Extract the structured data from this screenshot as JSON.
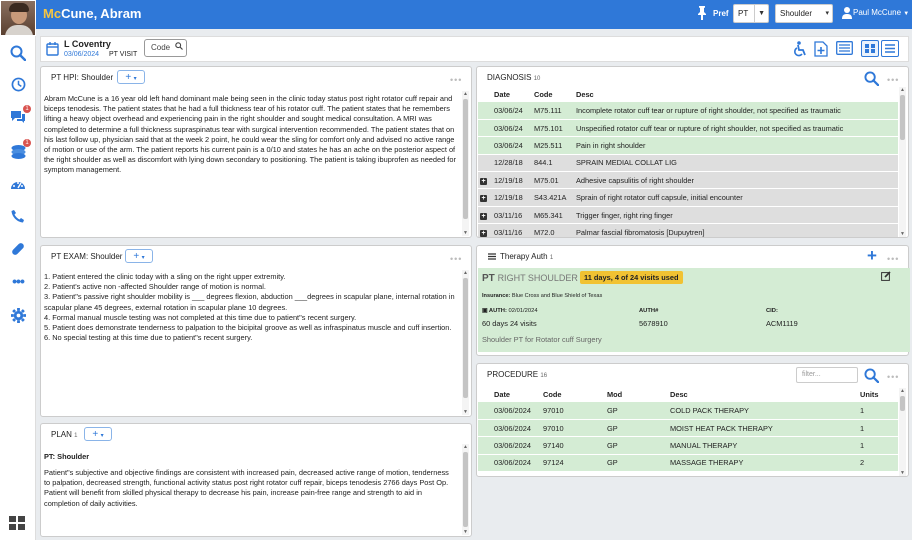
{
  "patient": {
    "initials_styled": "Mc",
    "name_rest": "Cune, Abram"
  },
  "topbar": {
    "pref_label": "Pref",
    "discipline_select": "PT",
    "body_part_select": "Shoulder",
    "user_name": "Paul McCune"
  },
  "sidebar": {
    "icons": [
      "search-icon",
      "clock-icon",
      "messages-icon",
      "tasks-icon",
      "dashboard-icon",
      "phone-icon",
      "pill-icon",
      "more-icon",
      "gear-icon"
    ],
    "badges": {
      "messages": "1",
      "tasks": "1"
    }
  },
  "header": {
    "provider": "L Coventry",
    "visit_date": "03/06/2024",
    "visit_type": "PT VISIT",
    "code_button": "Code"
  },
  "hpi": {
    "title": "PT HPI: Shoulder",
    "text": "Abram McCune is a 16 year old  left hand dominant male being seen in the clinic today status post right rotator cuff repair and biceps tenodesis. The patient states that he had a full thickness tear of his rotator cuff. The patient states that he remembers lifting a heavy object overhead and experiencing pain in the right shoulder and sought medical consultation. A MRI was completed to determine a full thickness supraspinatus tear with surgical intervention recommended. The patient states that on his last follow up, physician said that at the week 2 point, he could wear the sling for comfort only and advised no active range of motion or use of the arm. The patient reports his current pain is a 0/10 and states he has an ache on the posterior aspect of the right shoulder as well as discomfort with lying down secondary to positioning. The patient is taking ibuprofen as needed for symptom management."
  },
  "exam": {
    "title": "PT EXAM: Shoulder",
    "items": [
      "1.      Patient entered the clinic today with a sling on the right upper extremity.",
      "2.      Patient's active non -affected Shoulder range of motion is normal.",
      "3.      Patient\"s passive right shoulder mobility is ___ degrees flexion, abduction ___degrees in scapular plane, internal rotation in scapular plane 45 degrees, external rotation in scapular plane 10 degrees.",
      "4.      Formal manual muscle testing was not completed at this time due to patient\"s recent surgery.",
      "5.      Patient does demonstrate tenderness to palpation to the bicipital groove as well as infraspinatus muscle and cuff insertion.",
      "6.      No special testing at this time due to patient\"s recent surgery."
    ]
  },
  "plan": {
    "title": "PLAN",
    "count": "1",
    "heading": "PT: Shoulder",
    "text": "Patient\"s subjective and objective findings are consistent with increased pain, decreased active range of motion, tenderness to palpation, decreased strength, functional activity status post right rotator cuff repair, biceps tenodesis 2766 days Post Op. Patient will benefit from skilled physical therapy to decrease his pain, increase pain-free range and strength to aid in completion of daily activities."
  },
  "diagnosis": {
    "title": "DIAGNOSIS",
    "count": "10",
    "columns": [
      "Date",
      "Code",
      "Desc"
    ],
    "rows": [
      {
        "date": "03/06/24",
        "code": "M75.111",
        "desc": "Incomplete rotator cuff tear or rupture of right shoulder, not specified as traumatic",
        "style": "green",
        "expand": false
      },
      {
        "date": "03/06/24",
        "code": "M75.101",
        "desc": "Unspecified rotator cuff tear or rupture of right shoulder, not specified as traumatic",
        "style": "green",
        "expand": false
      },
      {
        "date": "03/06/24",
        "code": "M25.511",
        "desc": "Pain in right shoulder",
        "style": "green",
        "expand": false
      },
      {
        "date": "12/28/18",
        "code": "844.1",
        "desc": "SPRAIN MEDIAL COLLAT LIG",
        "style": "gray",
        "expand": false
      },
      {
        "date": "12/19/18",
        "code": "M75.01",
        "desc": "Adhesive capsulitis of right shoulder",
        "style": "gray",
        "expand": true
      },
      {
        "date": "12/19/18",
        "code": "S43.421A",
        "desc": "Sprain of right rotator cuff capsule, initial encounter",
        "style": "gray",
        "expand": true
      },
      {
        "date": "03/11/16",
        "code": "M65.341",
        "desc": "Trigger finger, right ring finger",
        "style": "gray",
        "expand": true
      },
      {
        "date": "03/11/16",
        "code": "M72.0",
        "desc": "Palmar fascial fibromatosis [Dupuytren]",
        "style": "gray",
        "expand": true
      }
    ]
  },
  "therapy_auth": {
    "title": "Therapy Auth",
    "count": "1",
    "discipline": "PT",
    "region": "RIGHT SHOULDER",
    "visits_used": "11 days, 4 of 24 visits used",
    "insurance_label": "Insurance:",
    "insurance": "Blue Cross and Blue Shield of Texas",
    "auth_label": "AUTH:",
    "auth_date": "02/01/2024",
    "auth_value": "60 days 24 visits",
    "auth_num_label": "AUTH#",
    "auth_num": "5678910",
    "cid_label": "CID:",
    "cid": "ACM1119",
    "description": "Shoulder PT for Rotator cuff Surgery"
  },
  "procedure": {
    "title": "PROCEDURE",
    "count": "16",
    "filter_placeholder": "filter...",
    "columns": [
      "Date",
      "Code",
      "Mod",
      "Desc",
      "Units"
    ],
    "rows": [
      {
        "date": "03/06/2024",
        "code": "97010",
        "mod": "GP",
        "desc": "COLD PACK THERAPY",
        "units": "1"
      },
      {
        "date": "03/06/2024",
        "code": "97010",
        "mod": "GP",
        "desc": "MOIST HEAT PACK THERAPY",
        "units": "1"
      },
      {
        "date": "03/06/2024",
        "code": "97140",
        "mod": "GP",
        "desc": "MANUAL THERAPY",
        "units": "1"
      },
      {
        "date": "03/06/2024",
        "code": "97124",
        "mod": "GP",
        "desc": "MASSAGE THERAPY",
        "units": "2"
      }
    ]
  },
  "colors": {
    "brand": "#2f78d8",
    "green_row": "#d4ecd4",
    "gray_row": "#dedede",
    "pill": "#f1c232"
  }
}
